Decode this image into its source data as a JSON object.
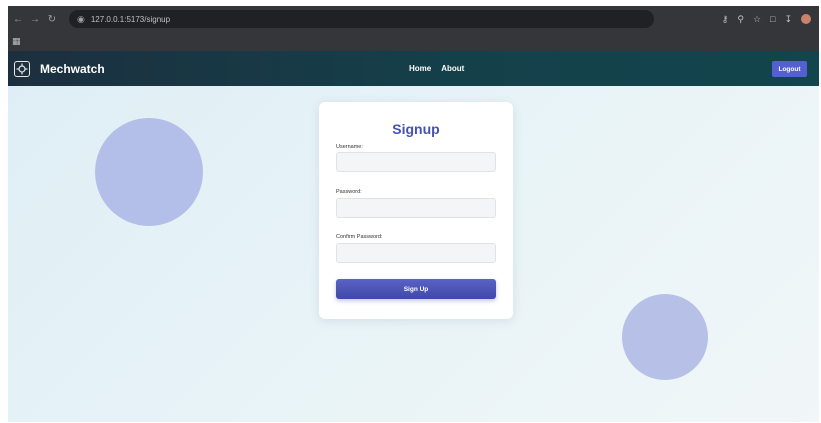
{
  "browser": {
    "url": "127.0.0.1:5173/signup",
    "back_icon": "arrow-left-icon",
    "forward_icon": "arrow-right-icon",
    "reload_icon": "reload-icon"
  },
  "header": {
    "brand": "Mechwatch",
    "nav": [
      {
        "label": "Home"
      },
      {
        "label": "About"
      }
    ],
    "logout_label": "Logout"
  },
  "signup_form": {
    "title": "Signup",
    "username_label": "Username:",
    "username_value": "",
    "password_label": "Password:",
    "password_value": "",
    "confirm_password_label": "Confirm Password:",
    "confirm_password_value": "",
    "submit_label": "Sign Up"
  },
  "colors": {
    "header_bg": "#14404a",
    "accent": "#4552b5",
    "logout_bg": "#5560d0",
    "circle": "#b4bfe9"
  }
}
